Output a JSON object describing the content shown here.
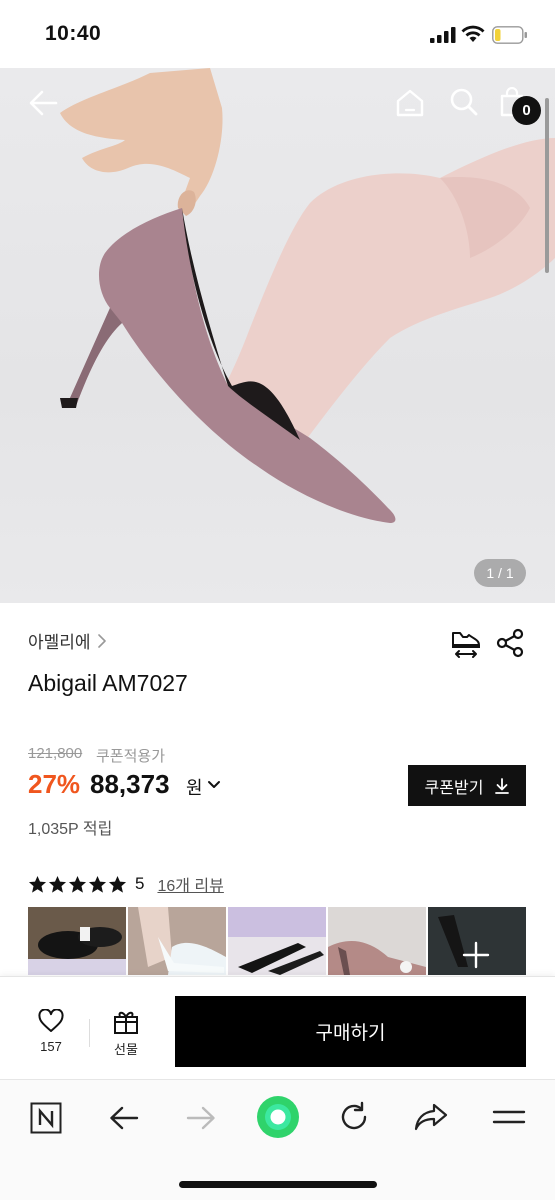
{
  "status_bar": {
    "time": "10:40"
  },
  "hero": {
    "cart_count": "0",
    "image_pager": "1 / 1"
  },
  "product": {
    "brand": "아멜리에",
    "title": "Abigail AM7027",
    "original_price": "121,800",
    "coupon_price_label": "쿠폰적용가",
    "discount": "27%",
    "price": "88,373",
    "currency": "원",
    "coupon_button": "쿠폰받기",
    "points": "1,035P 적립",
    "rating": "5",
    "review_link": "16개 리뷰",
    "star_count": 5
  },
  "purchase_bar": {
    "like_count": "157",
    "gift_label": "선물",
    "buy_label": "구매하기"
  },
  "browser_bar": {
    "icons": [
      "naver-n-icon",
      "back-arrow-icon",
      "forward-arrow-icon",
      "green-dot-icon",
      "reload-icon",
      "share-arrow-icon",
      "menu-icon"
    ]
  },
  "colors": {
    "discount": "#f0561e",
    "buy_button": "#000000",
    "accent_green": "#2fd36b"
  }
}
